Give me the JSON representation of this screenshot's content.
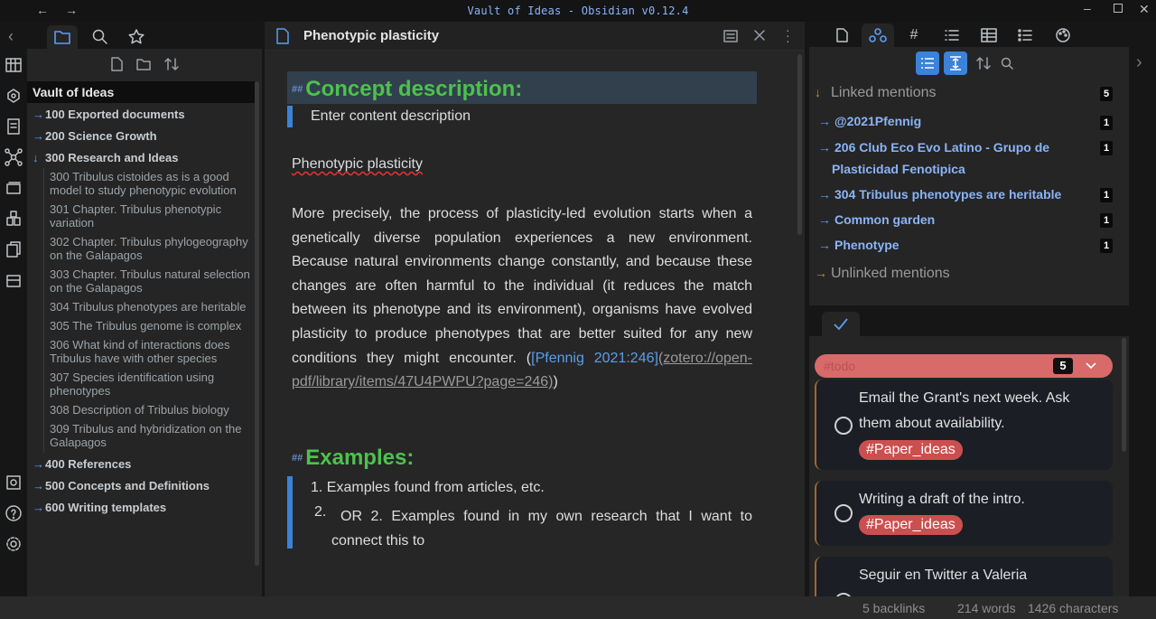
{
  "window": {
    "title": "Vault of Ideas - Obsidian v0.12.4"
  },
  "file_explorer": {
    "vault_name": "Vault of Ideas",
    "folders_before": [
      {
        "label": "100 Exported documents"
      },
      {
        "label": "200 Science Growth"
      }
    ],
    "open_folder": {
      "label": "300 Research and Ideas"
    },
    "files": [
      "300 Tribulus cistoides as is a good model to study phenotypic evolution",
      "301 Chapter. Tribulus phenotypic variation",
      "302 Chapter. Tribulus phylogeography on the Galapagos",
      "303 Chapter. Tribulus natural selection on the Galapagos",
      "304 Tribulus phenotypes are heritable",
      "305 The Tribulus genome is complex",
      "306 What kind of interactions does Tribulus have with other species",
      "307 Species identification using phenotypes",
      "308 Description of Tribulus biology",
      "309 Tribulus and hybridization on the Galapagos"
    ],
    "folders_after": [
      {
        "label": "400 References"
      },
      {
        "label": "500 Concepts and Definitions"
      },
      {
        "label": "600 Writing templates"
      }
    ]
  },
  "editor": {
    "note_title": "Phenotypic plasticity",
    "heading_marker": "##",
    "concept_heading": "Concept description:",
    "content_placeholder": "Enter content description",
    "plain_title": "Phenotypic plasticity",
    "paragraph": "More precisely, the process of plasticity-led evolution starts when a genetically diverse population experiences a new environment. Because natural environments change constantly, and because these changes are often harmful to the individual (it reduces the match between its phenotype and its environment), organisms have evolved plasticity to produce phenotypes that are better suited for any new conditions they might encounter. (",
    "citation_link": "[Pfennig 2021:246]",
    "citation_url": "(zotero://open-pdf/library/items/47U4PWPU?page=246)",
    "paragraph_end": ")",
    "examples_heading": "Examples:",
    "example1_num": "1.",
    "example1": "Examples found from articles, etc.",
    "example2_num": "2.",
    "example2": "OR 2. Examples found in my own research that I want to connect this to"
  },
  "backlinks": {
    "linked_label": "Linked mentions",
    "linked_count": "5",
    "items": [
      {
        "label": "@2021Pfennig",
        "count": "1"
      },
      {
        "label": "206 Club Eco Evo Latino - Grupo de Plasticidad Fenotipica",
        "count": "1"
      },
      {
        "label": "304 Tribulus phenotypes are heritable",
        "count": "1"
      },
      {
        "label": "Common garden",
        "count": "1"
      },
      {
        "label": "Phenotype",
        "count": "1"
      }
    ],
    "unlinked_label": "Unlinked mentions"
  },
  "todo": {
    "tag": "#todo",
    "count": "5",
    "cards": [
      {
        "text": "Email the Grant's next week. Ask them about availability.",
        "tag": "#Paper_ideas"
      },
      {
        "text": "Writing a draft of the intro.",
        "tag": "#Paper_ideas"
      },
      {
        "text": "Seguir en Twitter a Valeria",
        "tag": ""
      }
    ]
  },
  "status": {
    "backlinks": "5 backlinks",
    "words": "214 words",
    "characters": "1426 characters"
  },
  "colors": {
    "accent": "#5e9cf0",
    "heading": "#4cc24c",
    "tag": "#cc4f4f",
    "todo_header": "#d86a6a"
  }
}
